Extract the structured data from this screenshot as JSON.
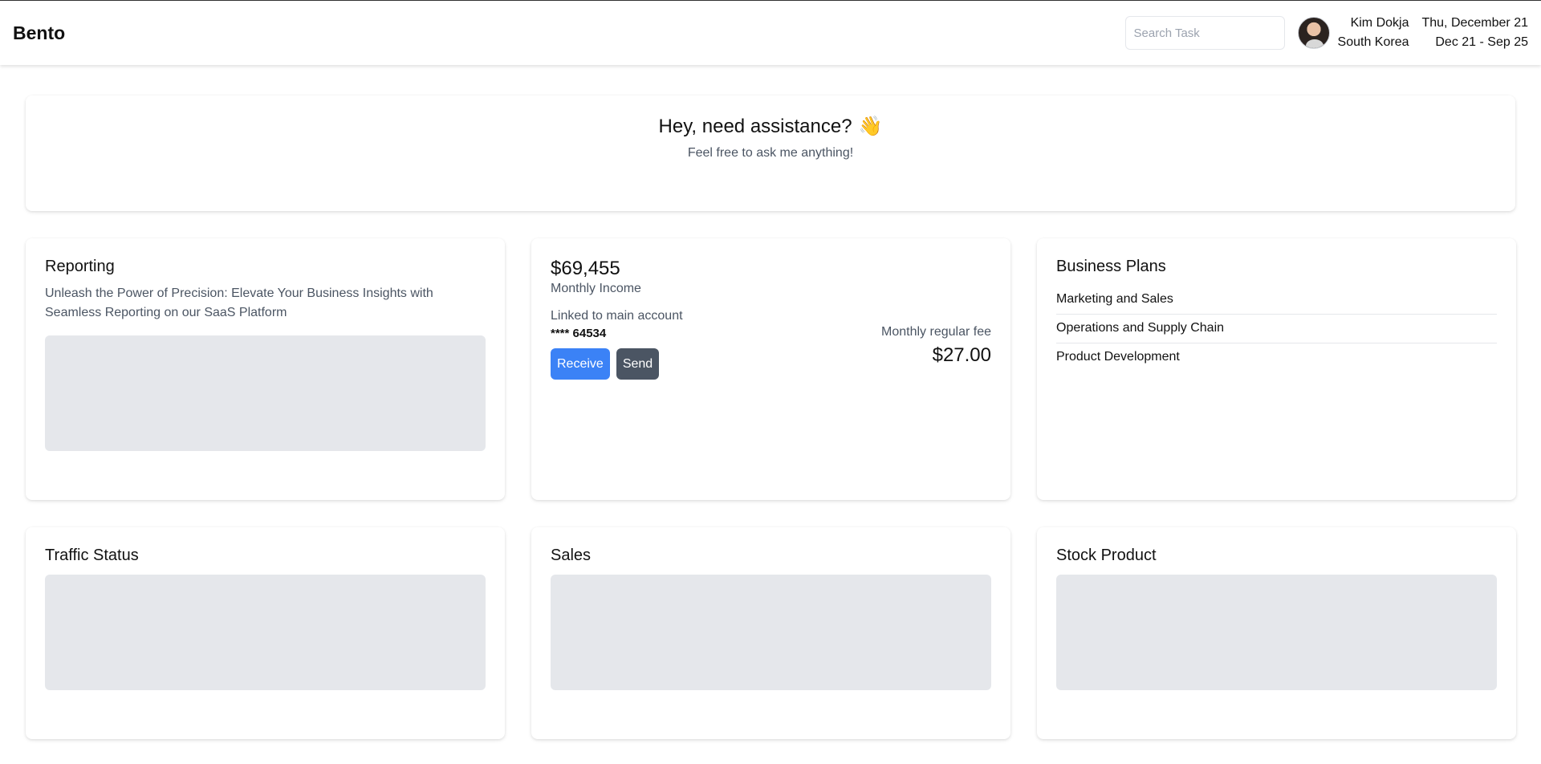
{
  "header": {
    "logo": "Bento",
    "search_placeholder": "Search Task",
    "user_name": "Kim Dokja",
    "user_location": "South Korea",
    "date_line1": "Thu, December 21",
    "date_line2": "Dec 21 - Sep 25"
  },
  "hero": {
    "title": "Hey, need assistance?",
    "emoji": "👋",
    "subtitle": "Feel free to ask me anything!"
  },
  "reporting": {
    "title": "Reporting",
    "description": "Unleash the Power of Precision: Elevate Your Business Insights with Seamless Reporting on our SaaS Platform"
  },
  "income": {
    "amount": "$69,455",
    "label": "Monthly Income",
    "linked_label": "Linked to main account",
    "account_number": "**** 64534",
    "receive_label": "Receive",
    "send_label": "Send",
    "fee_label": "Monthly regular fee",
    "fee_amount": "$27.00"
  },
  "business_plans": {
    "title": "Business Plans",
    "items": [
      "Marketing and Sales",
      "Operations and Supply Chain",
      "Product Development"
    ]
  },
  "traffic": {
    "title": "Traffic Status"
  },
  "sales": {
    "title": "Sales"
  },
  "stock": {
    "title": "Stock Product"
  },
  "colors": {
    "receive_button": "#3b82f6",
    "send_button": "#4b5563",
    "placeholder": "#e5e7eb"
  }
}
